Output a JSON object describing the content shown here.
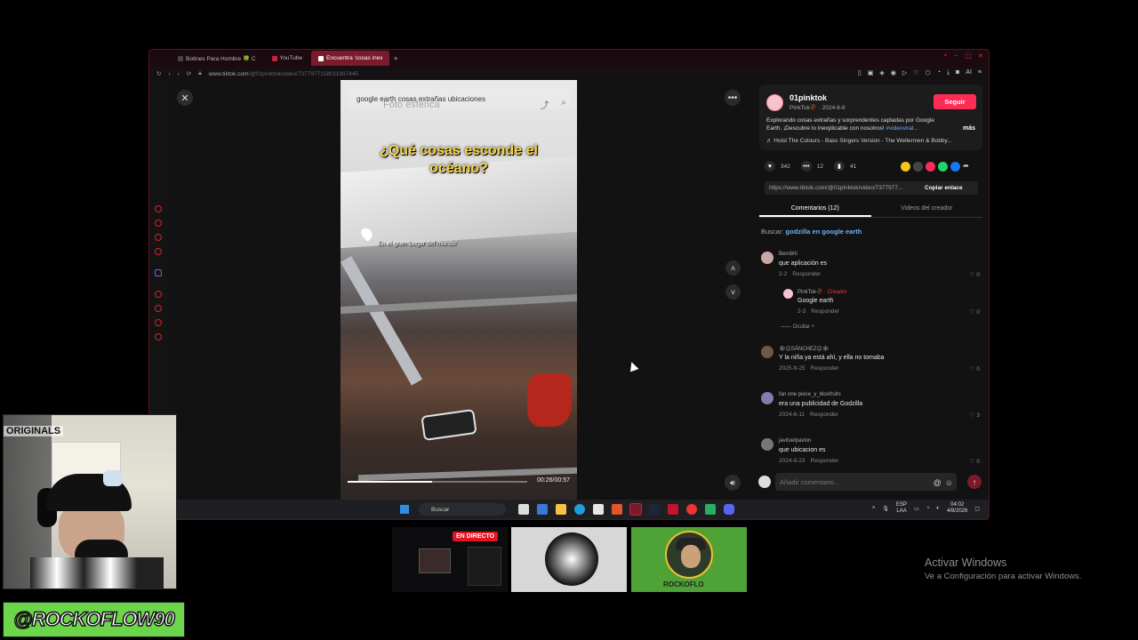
{
  "browser": {
    "tabs": [
      {
        "label": "Botines Para Hombre 🍀 C"
      },
      {
        "label": "YouTube"
      },
      {
        "label": "Encuentra 'cosas inex"
      }
    ],
    "url_host": "www.tiktok.com",
    "url_path": "/@01pinktok/video/7377977158011997445",
    "right_ai": "AI"
  },
  "video": {
    "search_text": "google earth cosas extrañas ubicaciones",
    "sub_text": "Foto esférica",
    "caption_line1": "¿Qué cosas esconde el",
    "caption_line2": "océano?",
    "place_text": "En el gran 'Lugar del mundo'",
    "progress_fraction": 0.47,
    "time": "00:26/00:57"
  },
  "panel": {
    "author": {
      "name": "01pinktok",
      "sub": "PinkTok🥀 · 2024-6-8",
      "follow_label": "Seguir",
      "desc": "Explorando cosas extrañas y sorprendentes captadas por Google Earth. ¡Descubre lo inexplicable con nosotros!",
      "desc_tag": "#videoviral...",
      "more_label": "más",
      "music": "♬ Hoist The Colours - Bass Singers Version - The Wellermen & Bobby..."
    },
    "actions": {
      "likes": "342",
      "comments": "12",
      "saves": "41"
    },
    "link": {
      "url": "https://www.tiktok.com/@01pinktok/video/7377977...",
      "copy_label": "Copiar enlace"
    },
    "tabs": {
      "comments": "Comentarios (12)",
      "creator_videos": "Videos del creador"
    },
    "search_hint": {
      "prefix": "Buscar:",
      "query": "godzilla en google earth"
    },
    "comments": [
      {
        "user": "Bern8ril",
        "text": "que aplicación es",
        "date": "2-2",
        "reply": "Responder",
        "likes": "0"
      },
      {
        "user": "PinkTok🥀",
        "creator": "· Creador",
        "text": "Google earth",
        "date": "2-3",
        "reply": "Responder",
        "likes": "0"
      },
      {
        "user": "🕸😊SÁNCHEZ😊🕸",
        "text": "Y la niña ya está ahí, y ella no tomaba",
        "date": "2025-9-25",
        "reply": "Responder",
        "likes": "0"
      },
      {
        "user": "fan one piece_y_bloxfruits",
        "text": "era una publicidad de Godzilla",
        "date": "2024-6-11",
        "reply": "Responder",
        "likes": "3"
      },
      {
        "user": "javitoelpavlon",
        "text": "que ubicacion es",
        "date": "2024-9-23",
        "reply": "Responder",
        "likes": "0"
      }
    ],
    "hide_label": "Ocultar",
    "input_placeholder": "Añadir comentario..."
  },
  "taskbar": {
    "search": "Buscar",
    "lang1": "ESP",
    "lang2": "LAA",
    "time": "04:02",
    "date": "4/8/2026"
  },
  "thumbs": {
    "live_label": "EN DIRECTO",
    "logo_text": "ROCKOFLO"
  },
  "webcam": {
    "poster_text": "ORIGINALS"
  },
  "handle": "@ROCKOFLOW90",
  "watermark": {
    "line1": "Activar Windows",
    "line2": "Ve a Configuración para activar Windows."
  }
}
